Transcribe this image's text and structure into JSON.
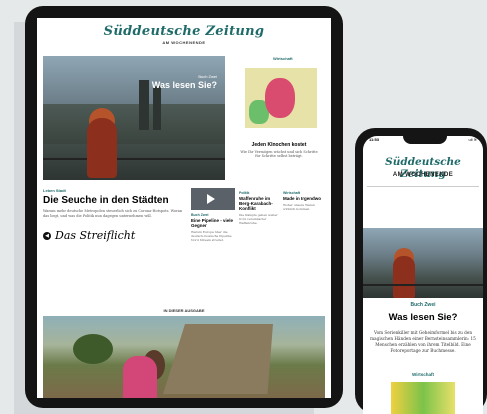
{
  "tablet": {
    "masthead": "Süddeutsche Zeitung",
    "subtitle": "AM WOCHENENDE",
    "hero": {
      "kicker": "Buch Zwei",
      "title": "Was lesen Sie?"
    },
    "side": {
      "kicker": "Wirtschaft",
      "title": "Jeden Klnochen kostet",
      "desc": "Wie Ihr Vermögen wächst und sich Schritte für Schritte selbst beträgt."
    },
    "feature": {
      "kicker": "Leben Stadt",
      "title": "Die Seuche in den Städten",
      "desc": "Warum mehr deutsche Metropolen steuerlich sich zu Corona-Hotspots. Woran das liegt, und was die Politik nun dagegen unternehmen will.",
      "streiflicht_icon": "speaker-icon",
      "streiflicht": "Das Streiflicht"
    },
    "col2": {
      "kicker": "Buch Zwei",
      "title": "Eine Pipeline - viele Gegner",
      "desc": "Warum Europa über die deutsch-russische Pipeline Nord Stream streitet."
    },
    "col3": {
      "kicker": "Politik",
      "title": "Waffenruhe im Berg-Karabach-Konflikt",
      "desc": "Die Kämpfe gehen weiter trotz vereinbarter Waffenruhe."
    },
    "col4": {
      "kicker": "Wirtschaft",
      "title": "Made in Irgendwo",
      "desc": "Woher unsere Waren wirklich kommen."
    },
    "section_label": "IN DIESER AUSGABE"
  },
  "phone": {
    "time": "11:53",
    "signal": "ull ≋",
    "masthead": "Süddeutsche Zeitung",
    "subtitle": "AM WOCHENENDE",
    "kicker": "Buch Zwei",
    "title": "Was lesen Sie?",
    "desc": "Vom Serienkiller mit Geheimformel bis zu den magischen Händen einer Bernsteinsammlerin: 15 Menschen erzählen von ihrem Titelbild. Eine Fotoreportage zur Buchmesse.",
    "kicker2": "Wirtschaft"
  }
}
